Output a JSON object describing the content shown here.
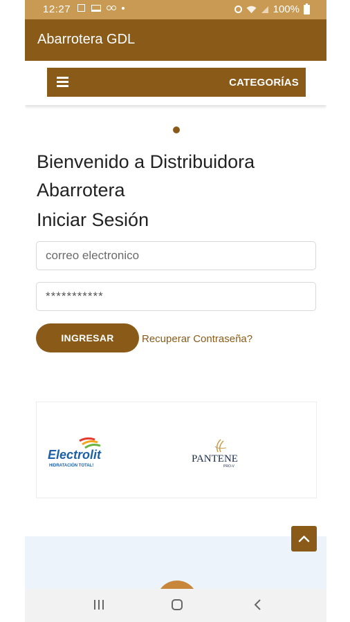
{
  "status_bar": {
    "time": "12:27",
    "battery": "100%",
    "icons": [
      "image-icon",
      "laptop-icon",
      "voicemail-icon",
      "dot-icon",
      "alarm-icon",
      "wifi-icon",
      "signal-icon",
      "battery-icon"
    ]
  },
  "app_bar": {
    "title": "Abarrotera GDL"
  },
  "navbar": {
    "menu_icon": "hamburger-icon",
    "categories_label": "CATEGORÍAS"
  },
  "welcome": {
    "line1": "Bienvenido a Distribuidora",
    "line2": "Abarrotera",
    "login_title": "Iniciar Sesión"
  },
  "form": {
    "email_placeholder": "correo electronico",
    "email_value": "",
    "password_value": "***********",
    "submit_label": "INGRESAR",
    "recover_label": "Recuperar Contraseña?"
  },
  "brands": [
    {
      "name": "Electrolit",
      "tagline": "HIDRATACIÓN TOTAL!"
    },
    {
      "name": "PANTENE",
      "tagline": "PRO-V"
    }
  ],
  "colors": {
    "primary": "#8a5a19",
    "status_bar": "#c89a54",
    "footer": "#ecf3fb"
  },
  "system_nav": {
    "icons": [
      "recent-apps-icon",
      "home-icon",
      "back-icon"
    ]
  }
}
